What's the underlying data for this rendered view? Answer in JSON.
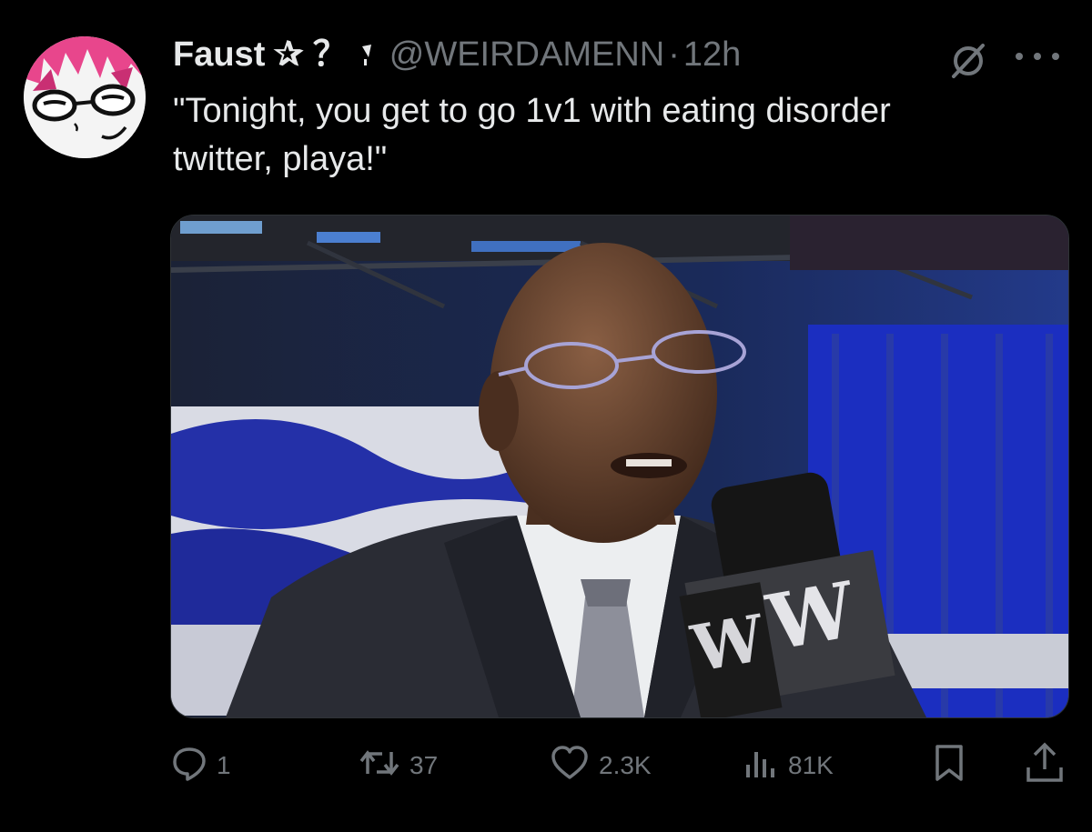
{
  "author": {
    "name": "Faust",
    "name_emoji": "✰ ？",
    "handle": "@WEIRDAMENN",
    "separator": "·",
    "time": "12h"
  },
  "tweet": {
    "text": "\"Tonight, you get to go 1v1 with eating disorder twitter, playa!\""
  },
  "media": {
    "mic_logo": "W"
  },
  "actions": {
    "replies": "1",
    "reposts": "37",
    "likes": "2.3K",
    "views": "81K"
  },
  "icons": {
    "grok": "grok-icon",
    "more": "more-icon",
    "reply": "reply-icon",
    "repost": "repost-icon",
    "like": "heart-icon",
    "views": "views-icon",
    "bookmark": "bookmark-icon",
    "share": "share-icon"
  },
  "colors": {
    "background": "#000000",
    "text": "#e7e9ea",
    "secondary": "#71767b",
    "avatar_accent": "#e8468c"
  }
}
